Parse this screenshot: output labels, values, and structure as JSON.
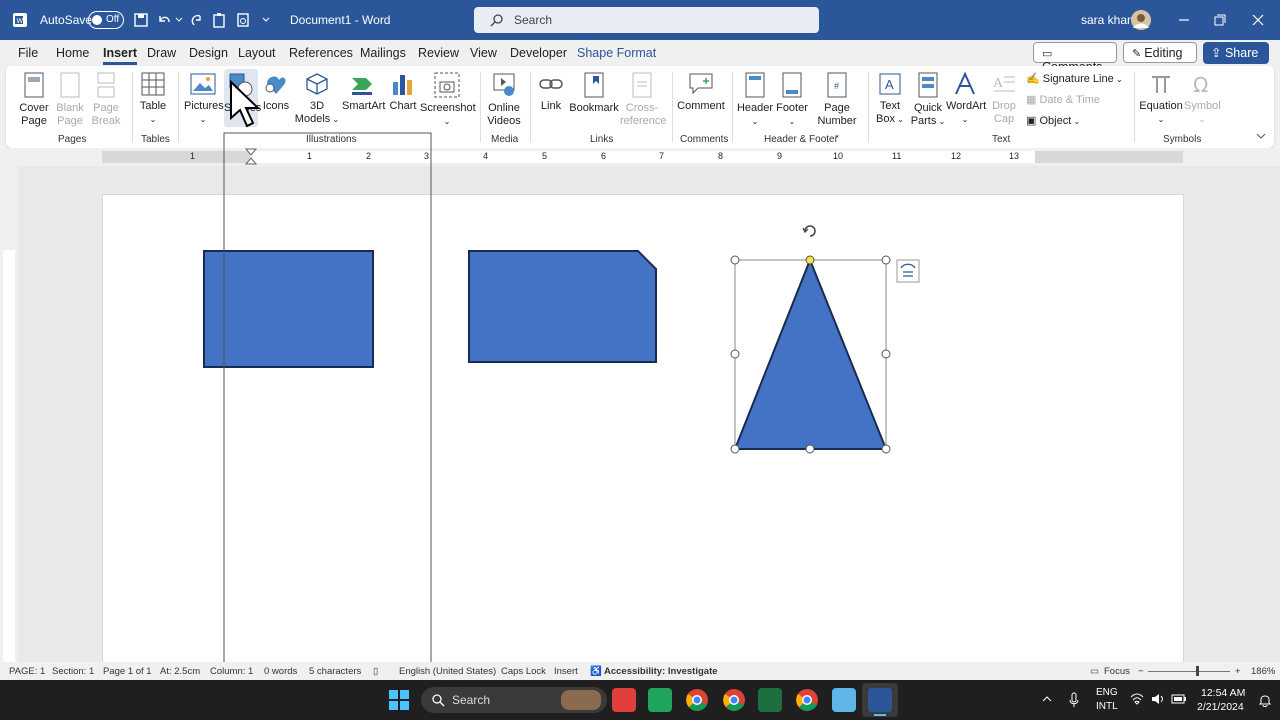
{
  "titlebar": {
    "autosave": "AutoSave",
    "toggle": "Off",
    "document": "Document1  -  Word",
    "search_placeholder": "Search",
    "user": "sara khan"
  },
  "menu": {
    "tabs": [
      "File",
      "Home",
      "Insert",
      "Draw",
      "Design",
      "Layout",
      "References",
      "Mailings",
      "Review",
      "View",
      "Developer",
      "Shape Format"
    ],
    "comments": "Comments",
    "editing": "Editing",
    "share": "Share"
  },
  "ribbon": {
    "pages": {
      "cover": "Cover\nPage",
      "blank": "Blank\nPage",
      "break": "Page\nBreak",
      "label": "Pages"
    },
    "tables": {
      "table": "Table",
      "label": "Tables"
    },
    "illustrations": {
      "pictures": "Pictures",
      "shapes": "Shapes",
      "icons": "Icons",
      "models": "3D\nModels",
      "smartart": "SmartArt",
      "chart": "Chart",
      "screenshot": "Screenshot",
      "label": "Illustrations"
    },
    "media": {
      "online": "Online\nVideos",
      "label": "Media"
    },
    "links": {
      "link": "Link",
      "bookmark": "Bookmark",
      "cross": "Cross-\nreference",
      "label": "Links"
    },
    "comments": {
      "comment": "Comment",
      "label": "Comments"
    },
    "hf": {
      "header": "Header",
      "footer": "Footer",
      "page_number": "Page\nNumber",
      "label": "Header & Footer"
    },
    "text": {
      "textbox": "Text\nBox",
      "quickparts": "Quick\nParts",
      "wordart": "WordArt",
      "dropcap": "Drop\nCap",
      "signature": "Signature Line",
      "datetime": "Date & Time",
      "object": "Object",
      "label": "Text"
    },
    "symbols": {
      "equation": "Equation",
      "symbol": "Symbol",
      "label": "Symbols"
    }
  },
  "ruler": {
    "marks": [
      "1",
      "1",
      "2",
      "3",
      "4",
      "5",
      "6",
      "7",
      "8",
      "9",
      "10",
      "11",
      "12",
      "13"
    ]
  },
  "status": {
    "page": "PAGE: 1",
    "section": "Section: 1",
    "pageof": "Page 1 of 1",
    "at": "At: 2.5cm",
    "column": "Column: 1",
    "words": "0 words",
    "chars": "5 characters",
    "lang": "English (United States)",
    "caps": "Caps Lock",
    "insert": "Insert",
    "access": "Accessibility: Investigate",
    "focus": "Focus",
    "zoom": "186%"
  },
  "taskbar": {
    "search": "Search",
    "lang1": "ENG",
    "lang2": "INTL",
    "time": "12:54 AM",
    "date": "2/21/2024"
  },
  "colors": {
    "accent": "#2b579a",
    "shape_fill": "#4472c4",
    "shape_stroke": "#172c51"
  }
}
